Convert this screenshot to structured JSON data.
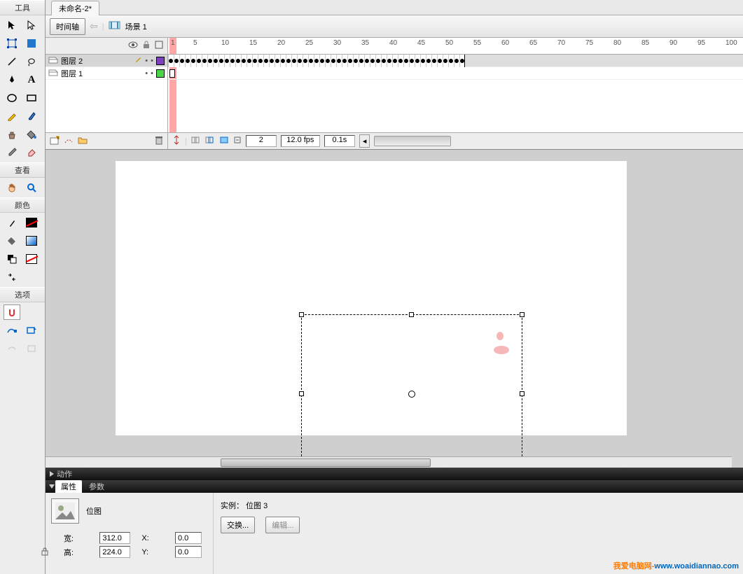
{
  "tools": {
    "title": "工具",
    "view_title": "查看",
    "color_title": "颜色",
    "options_title": "选项"
  },
  "document": {
    "tab_name": "未命名-2*"
  },
  "crumb": {
    "timeline_btn": "时间轴",
    "scene": "场景 1"
  },
  "layers": {
    "items": [
      {
        "name": "图层 2",
        "color": "#7b3fbf",
        "selected": true
      },
      {
        "name": "图层 1",
        "color": "#48d648",
        "selected": false
      }
    ]
  },
  "timeline": {
    "ticks": [
      1,
      5,
      10,
      15,
      20,
      25,
      30,
      35,
      40,
      45,
      50,
      55,
      60,
      65,
      70,
      75,
      80,
      85,
      90,
      95,
      100
    ],
    "current_frame": "2",
    "fps": "12.0 fps",
    "time": "0.1s",
    "keyframe_end": 53
  },
  "actions": {
    "label": "动作"
  },
  "props": {
    "tab1": "属性",
    "tab2": "参数",
    "type": "位图",
    "instance_label": "实例：",
    "instance_name": "位图 3",
    "swap_btn": "交换...",
    "edit_btn": "编辑...",
    "w_label": "宽:",
    "h_label": "高:",
    "x_label": "X:",
    "y_label": "Y:",
    "w": "312.0",
    "h": "224.0",
    "x": "0.0",
    "y": "0.0"
  },
  "watermark": {
    "a": "我爱电脑网-",
    "b": "www.woaidiannao.com"
  }
}
